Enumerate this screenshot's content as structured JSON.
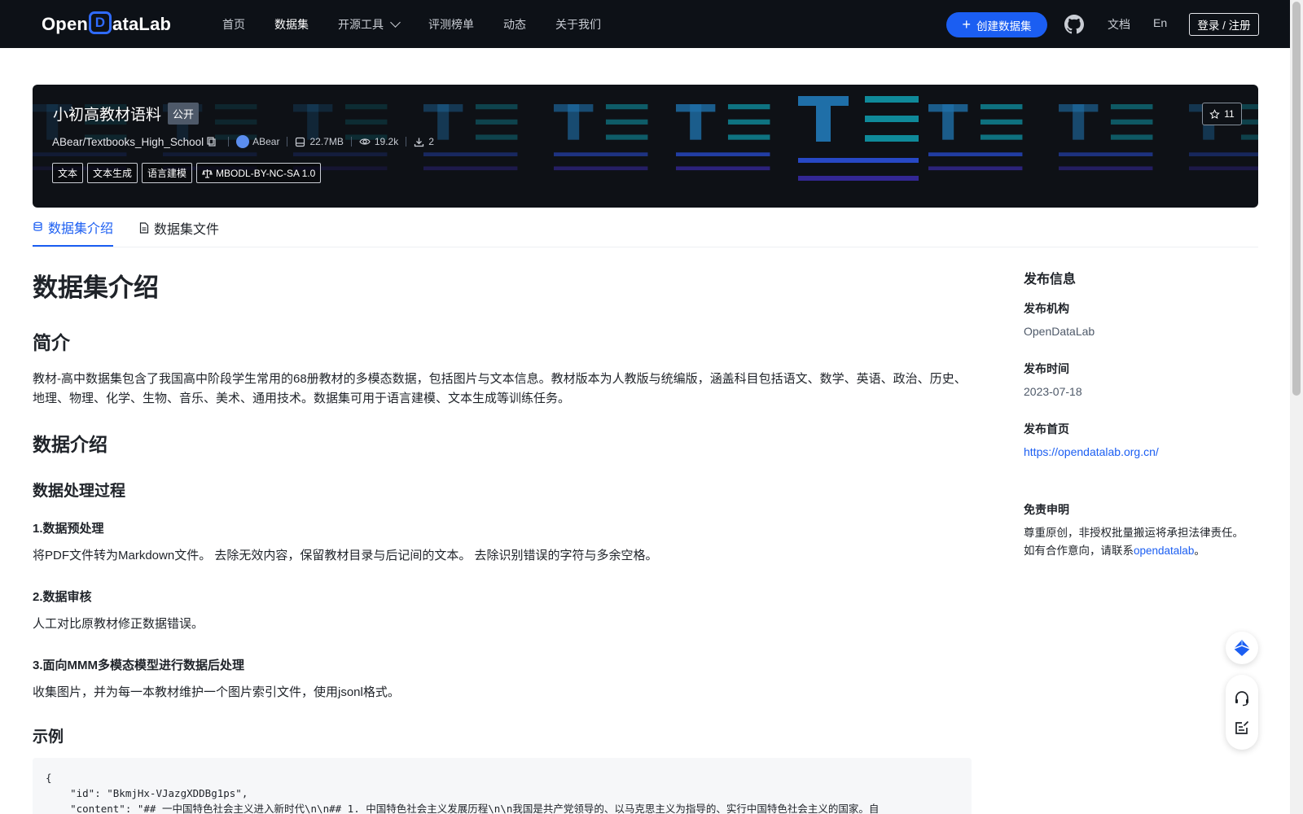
{
  "nav": {
    "items": [
      "首页",
      "数据集",
      "开源工具",
      "评测榜单",
      "动态",
      "关于我们"
    ],
    "create_label": "创建数据集",
    "docs": "文档",
    "lang": "En",
    "login": "登录 / 注册"
  },
  "brand": {
    "left": "Open",
    "right": "ataLab",
    "mark": "D"
  },
  "dataset": {
    "title": "小初高教材语料",
    "visibility": "公开",
    "path": "ABear/Textbooks_High_School",
    "owner": "ABear",
    "size": "22.7MB",
    "views": "19.2k",
    "downloads": "2",
    "stars": "11",
    "tags": [
      "文本",
      "文本生成",
      "语言建模"
    ],
    "license": "MBODL-BY-NC-SA 1.0"
  },
  "tabs": [
    "数据集介绍",
    "数据集文件"
  ],
  "article": {
    "h1": "数据集介绍",
    "intro_h": "简介",
    "intro_p": "教材-高中数据集包含了我国高中阶段学生常用的68册教材的多模态数据，包括图片与文本信息。教材版本为人教版与统编版，涵盖科目包括语文、数学、英语、政治、历史、地理、物理、化学、生物、音乐、美术、通用技术。数据集可用于语言建模、文本生成等训练任务。",
    "data_h": "数据介绍",
    "process_h": "数据处理过程",
    "step1_h": "1.数据预处理",
    "step1_p": "将PDF文件转为Markdown文件。 去除无效内容，保留教材目录与后记间的文本。 去除识别错误的字符与多余空格。",
    "step2_h": "2.数据审核",
    "step2_p": "人工对比原教材修正数据错误。",
    "step3_h": "3.面向MMM多模态模型进行数据后处理",
    "step3_p": "收集图片，并为每一本教材维护一个图片索引文件，使用jsonl格式。",
    "example_h": "示例",
    "code": "{\n    \"id\": \"BkmjHx-VJazgXDDBg1ps\",\n    \"content\": \"## 一中国特色社会主义进入新时代\\n\\n## 1. 中国特色社会主义发展历程\\n\\n我国是共产党领导的、以马克思主义为指导的、实行中国特色社会主义的国家。自"
  },
  "sidebar": {
    "title": "发布信息",
    "org_label": "发布机构",
    "org_value": "OpenDataLab",
    "time_label": "发布时间",
    "time_value": "2023-07-18",
    "home_label": "发布首页",
    "home_value": "https://opendatalab.org.cn/",
    "disclaimer_label": "免责申明",
    "disclaimer_line1": "尊重原创，非授权批量搬运将承担法律责任。",
    "disclaimer_line2_pre": "如有合作意向，请联系",
    "disclaimer_link": "opendatalab",
    "disclaimer_line2_post": "。"
  },
  "colors": {
    "accent": "#1b5ef2",
    "topbar": "#0d1117",
    "hero": "#0e1116"
  }
}
